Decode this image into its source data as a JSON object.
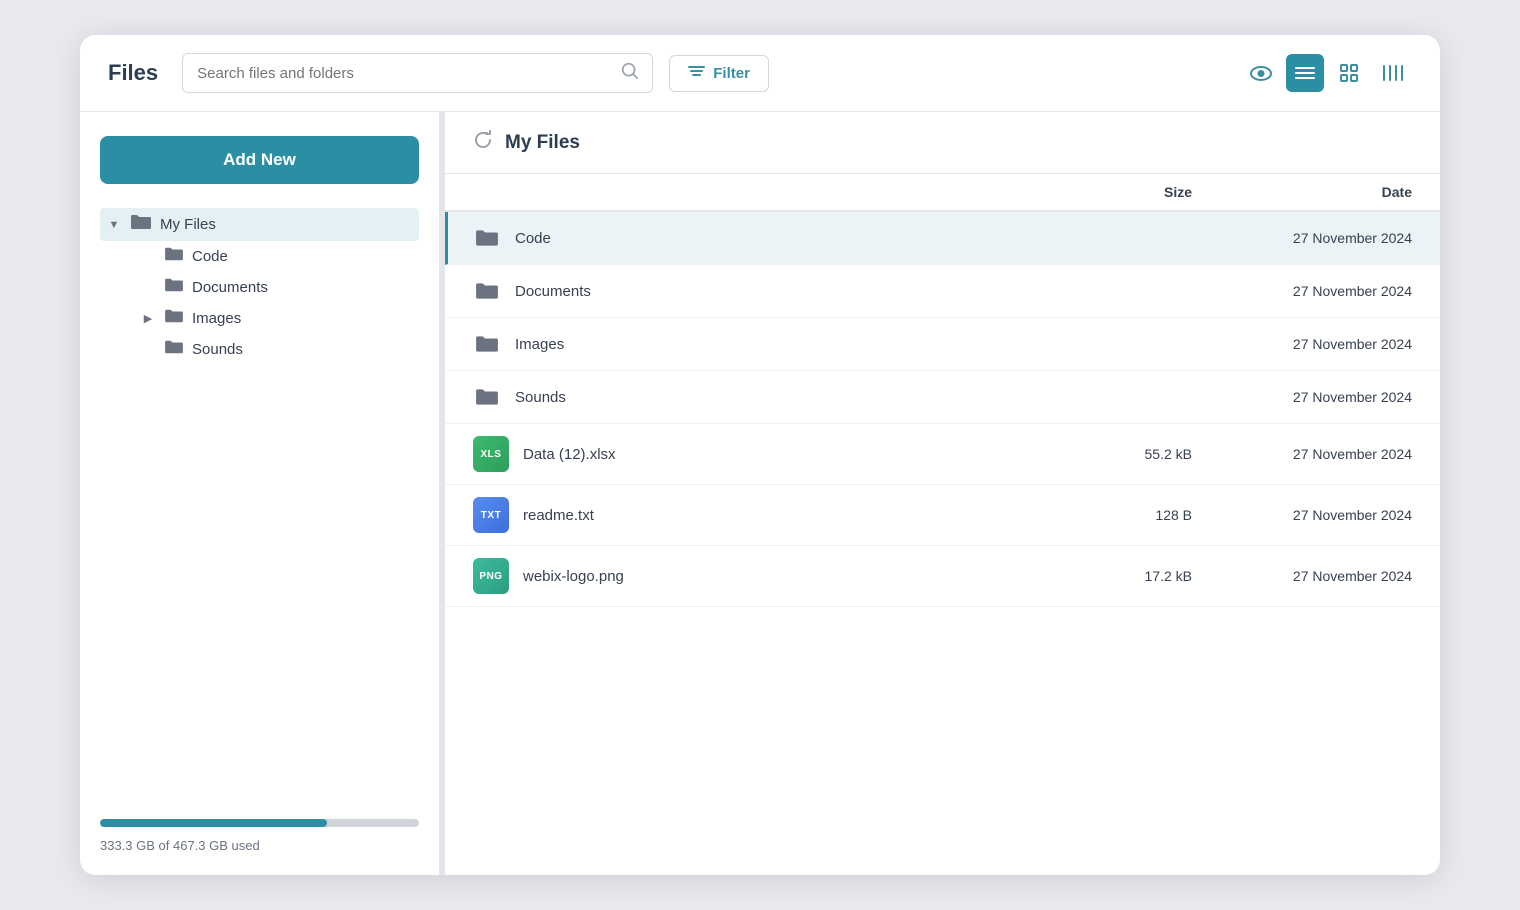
{
  "header": {
    "title": "Files",
    "search_placeholder": "Search files and folders",
    "filter_label": "Filter"
  },
  "view_controls": {
    "eye_label": "Preview",
    "list_label": "List view",
    "grid_label": "Grid view",
    "columns_label": "Columns view"
  },
  "sidebar": {
    "add_new_label": "Add New",
    "tree": {
      "root_label": "My Files",
      "children": [
        {
          "label": "Code",
          "has_children": false,
          "expanded": false
        },
        {
          "label": "Documents",
          "has_children": false,
          "expanded": false
        },
        {
          "label": "Images",
          "has_children": true,
          "expanded": false
        },
        {
          "label": "Sounds",
          "has_children": false,
          "expanded": false
        }
      ]
    },
    "storage": {
      "label": "333.3 GB of 467.3 GB used",
      "used_gb": 333.3,
      "total_gb": 467.3,
      "percent": 71.3
    }
  },
  "main": {
    "section_title": "My Files",
    "table": {
      "col_name": "",
      "col_size": "Size",
      "col_date": "Date",
      "rows": [
        {
          "type": "folder",
          "name": "Code",
          "size": "",
          "date": "27 November 2024",
          "selected": true
        },
        {
          "type": "folder",
          "name": "Documents",
          "size": "",
          "date": "27 November 2024",
          "selected": false
        },
        {
          "type": "folder",
          "name": "Images",
          "size": "",
          "date": "27 November 2024",
          "selected": false
        },
        {
          "type": "folder",
          "name": "Sounds",
          "size": "",
          "date": "27 November 2024",
          "selected": false
        },
        {
          "type": "file",
          "badge": "XLS",
          "badge_class": "badge-xls",
          "name": "Data (12).xlsx",
          "size": "55.2 kB",
          "date": "27 November 2024",
          "selected": false
        },
        {
          "type": "file",
          "badge": "TXT",
          "badge_class": "badge-txt",
          "name": "readme.txt",
          "size": "128 B",
          "date": "27 November 2024",
          "selected": false
        },
        {
          "type": "file",
          "badge": "PNG",
          "badge_class": "badge-png",
          "name": "webix-logo.png",
          "size": "17.2 kB",
          "date": "27 November 2024",
          "selected": false
        }
      ]
    }
  }
}
